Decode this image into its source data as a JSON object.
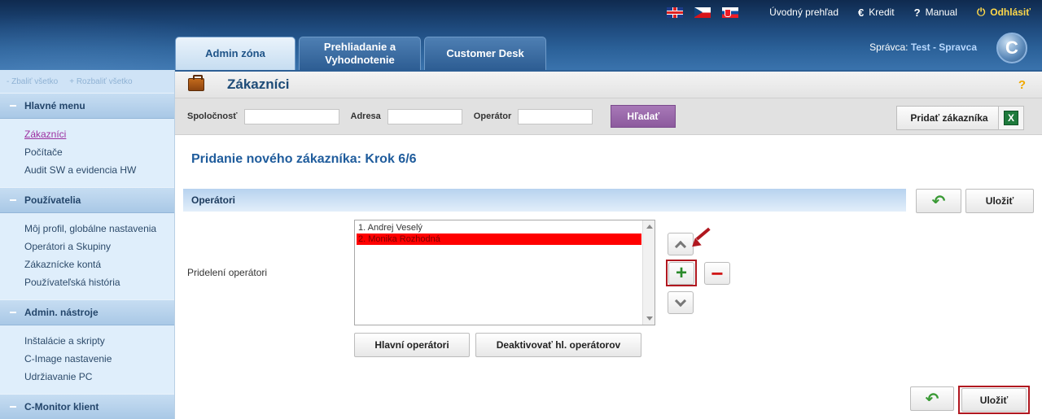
{
  "topbar": {
    "flags": [
      "flag-uk",
      "flag-cz",
      "flag-sk"
    ],
    "overview": "Úvodný prehľad",
    "credit": "Kredit",
    "credit_icon": "€",
    "manual": "Manual",
    "manual_icon": "?",
    "logout": "Odhlásiť",
    "logout_icon": "⏻"
  },
  "tabs": [
    {
      "label": "Admin zóna",
      "active": true
    },
    {
      "label": "Prehliadanie a Vyhodnotenie",
      "active": false
    },
    {
      "label": "Customer Desk",
      "active": false
    }
  ],
  "admin": {
    "label": "Správca:",
    "name": "Test - Spravca"
  },
  "logo_letter": "C",
  "sidebar": {
    "collapse_all": "- Zbaliť všetko",
    "expand_all": "+ Rozbaliť všetko",
    "sections": [
      {
        "title": "Hlavné menu",
        "items": [
          "Zákazníci",
          "Počítače",
          "Audit SW a evidencia HW"
        ]
      },
      {
        "title": "Používatelia",
        "items": [
          "Môj profil, globálne nastavenia",
          "Operátori a Skupiny",
          "Zákaznícke kontá",
          "Používateľská história"
        ]
      },
      {
        "title": "Admin. nástroje",
        "items": [
          "Inštalácie a skripty",
          "C-Image nastavenie",
          "Udržiavanie PC"
        ]
      },
      {
        "title": "C-Monitor klient",
        "items": []
      }
    ]
  },
  "page": {
    "title": "Zákazníci",
    "help": "?"
  },
  "filter": {
    "company_label": "Spoločnosť",
    "address_label": "Adresa",
    "operator_label": "Operátor",
    "company_value": "",
    "address_value": "",
    "operator_value": "",
    "search_button": "Hľadať",
    "add_customer_button": "Pridať zákazníka",
    "excel_icon": "X"
  },
  "wizard": {
    "step_title": "Pridanie nového zákazníka: Krok 6/6",
    "section_title": "Operátori",
    "save_label": "Uložiť",
    "assigned_label": "Pridelení operátori",
    "operators": [
      "1. Andrej Veselý",
      "2. Monika Rozhodná"
    ],
    "selected_index": 1,
    "main_operators_button": "Hlavní operátori",
    "deactivate_button": "Deaktivovať hl. operátorov",
    "plus": "+",
    "minus": "−"
  },
  "colors": {
    "accent_purple": "#8c5a9e",
    "selected_red": "#ff0000",
    "highlight": "#b0171f",
    "title_blue": "#1f5c9c"
  }
}
